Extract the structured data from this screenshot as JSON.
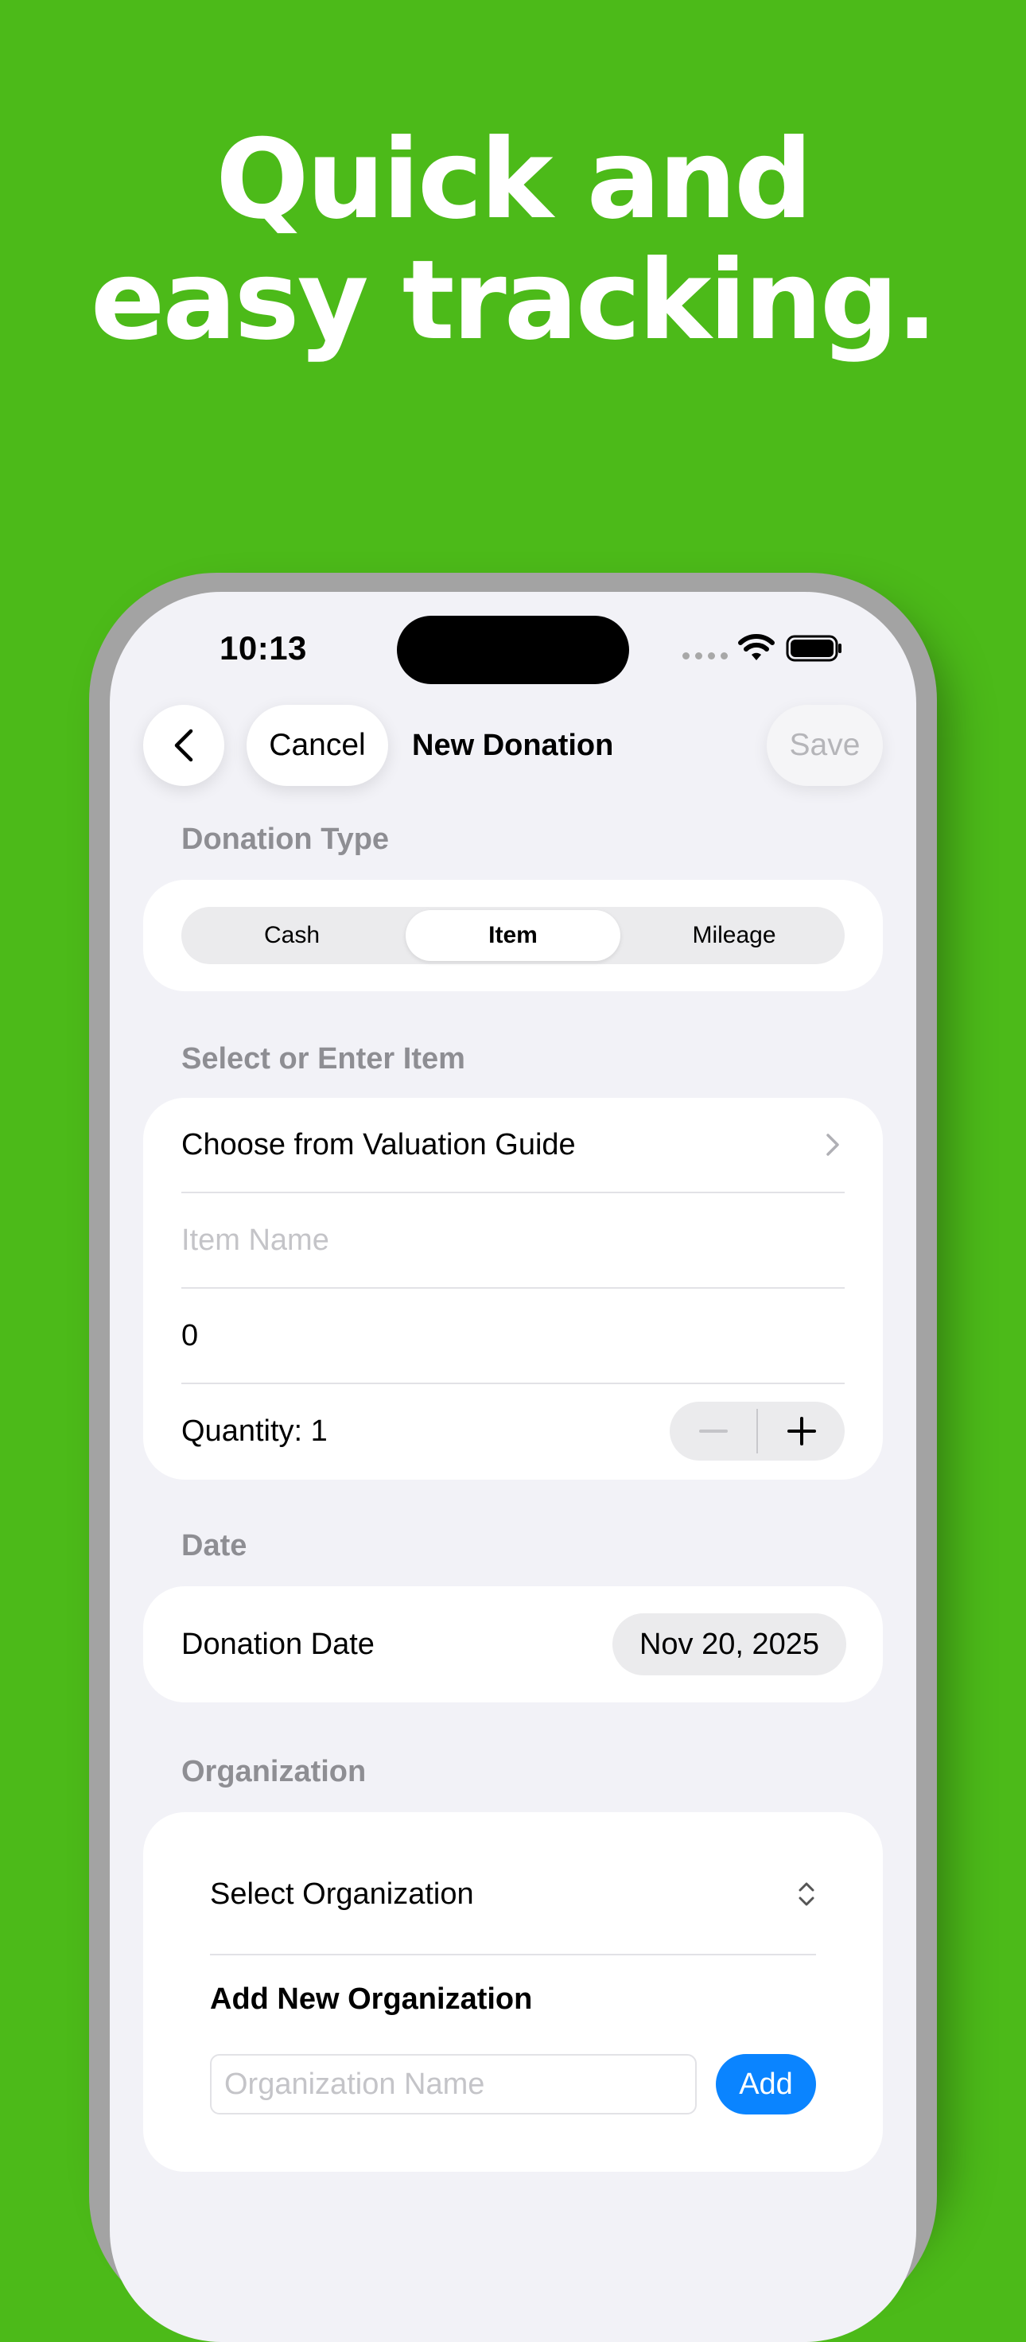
{
  "headline": {
    "line1": "Quick and",
    "line2": "easy tracking."
  },
  "status_bar": {
    "time": "10:13"
  },
  "nav": {
    "back_icon": "chevron-left-icon",
    "cancel_label": "Cancel",
    "title": "New Donation",
    "save_label": "Save"
  },
  "donation_type": {
    "header": "Donation Type",
    "options": [
      "Cash",
      "Item",
      "Mileage"
    ],
    "selected": "Item"
  },
  "item_section": {
    "header": "Select or Enter Item",
    "valuation_label": "Choose from Valuation Guide",
    "item_name_placeholder": "Item Name",
    "value": "0",
    "quantity_label": "Quantity: 1",
    "minus": "−",
    "plus": "+"
  },
  "date_section": {
    "header": "Date",
    "label": "Donation Date",
    "value": "Nov 20, 2025"
  },
  "organization_section": {
    "header": "Organization",
    "select_label": "Select Organization",
    "add_new_title": "Add New Organization",
    "name_placeholder": "Organization Name",
    "add_label": "Add"
  },
  "colors": {
    "background": "#4cba19",
    "accent": "#0a84ff",
    "screen": "#f2f2f7"
  }
}
